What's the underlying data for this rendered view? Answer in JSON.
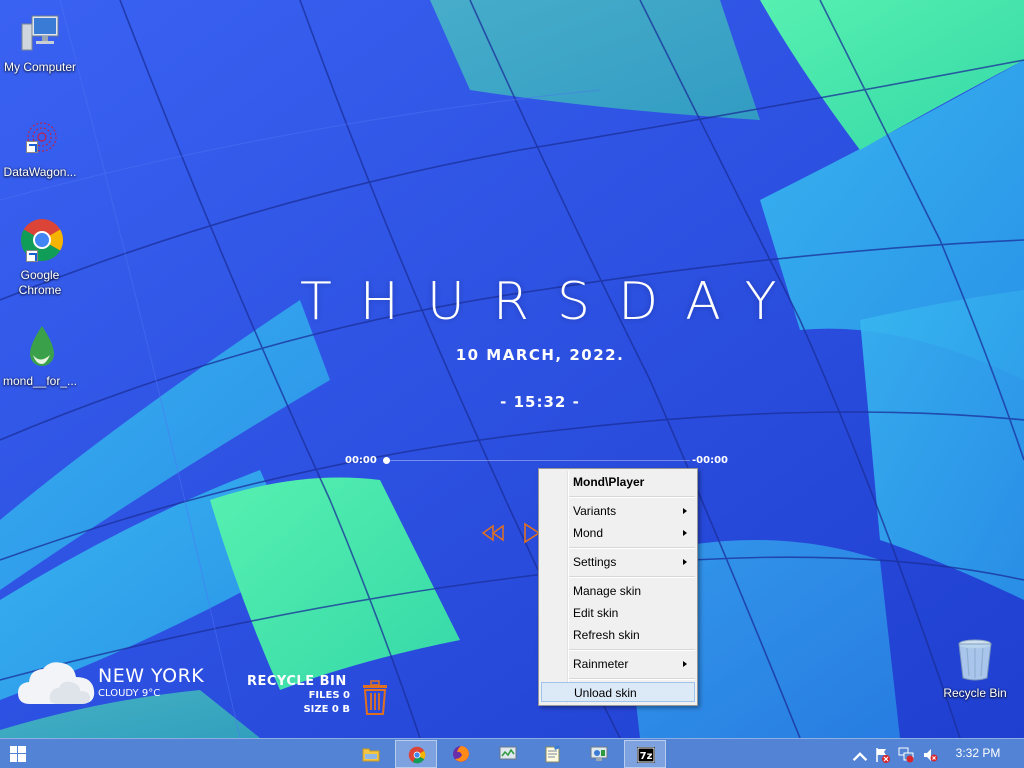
{
  "desktop": {
    "icons": [
      {
        "label": "My Computer"
      },
      {
        "label": "DataWagon..."
      },
      {
        "label": "Google Chrome"
      },
      {
        "label": "mond__for_..."
      },
      {
        "label": "Recycle Bin"
      }
    ]
  },
  "clock": {
    "day": "THURSDAY",
    "date": "10  MARCH,  2022.",
    "time": "- 15:32 -"
  },
  "player": {
    "elapsed": "00:00",
    "remaining": "-00:00"
  },
  "weather": {
    "city": "NEW YORK",
    "condition": "CLOUDY 9°C"
  },
  "recycle_skin": {
    "title": "RECYCLE BIN",
    "files": "FILES 0",
    "size": "SIZE 0 B"
  },
  "context_menu": {
    "header": "Mond\\Player",
    "items": [
      {
        "label": "Variants",
        "submenu": true
      },
      {
        "label": "Mond",
        "submenu": true
      },
      {
        "label": "Settings",
        "submenu": true
      },
      {
        "label": "Manage skin",
        "submenu": false
      },
      {
        "label": "Edit skin",
        "submenu": false
      },
      {
        "label": "Refresh skin",
        "submenu": false
      },
      {
        "label": "Rainmeter",
        "submenu": true
      },
      {
        "label": "Unload skin",
        "submenu": false,
        "highlighted": true
      }
    ]
  },
  "taskbar": {
    "apps": [
      "file-explorer",
      "chrome",
      "firefox",
      "task-manager",
      "notepad",
      "control-panel",
      "7zip"
    ],
    "clock": "3:32 PM"
  },
  "colors": {
    "accent": "#e07020",
    "menu_bg": "#f0f0f0",
    "highlight": "#dce9f7"
  }
}
